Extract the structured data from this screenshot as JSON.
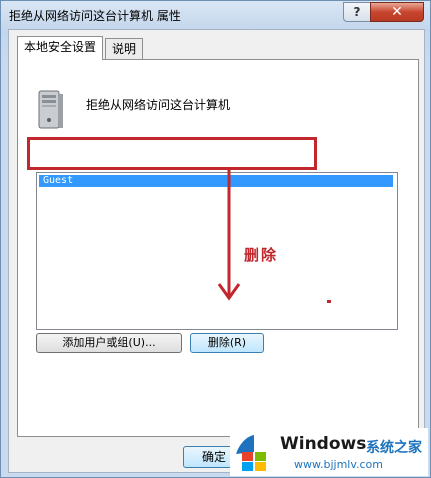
{
  "window": {
    "title": "拒绝从网络访问这台计算机 属性",
    "help_label": "?",
    "close_label": "✕"
  },
  "tabs": [
    {
      "label": "本地安全设置",
      "active": true
    },
    {
      "label": "说明",
      "active": false
    }
  ],
  "policy": {
    "icon": "computer-tower-icon",
    "title": "拒绝从网络访问这台计算机"
  },
  "list": {
    "items": [
      "Guest"
    ],
    "selected": "Guest"
  },
  "buttons": {
    "add_label": "添加用户或组(U)...",
    "remove_label": "删除(R)",
    "ok_label": "确定"
  },
  "annotation": {
    "label": "删除",
    "color": "#c1272d"
  },
  "watermark": {
    "brand": "Windows",
    "site": "系统之家",
    "url": "www.bjjmlv.com"
  },
  "colors": {
    "selection": "#3399ff",
    "title_gradient": "#c4d6ec"
  }
}
